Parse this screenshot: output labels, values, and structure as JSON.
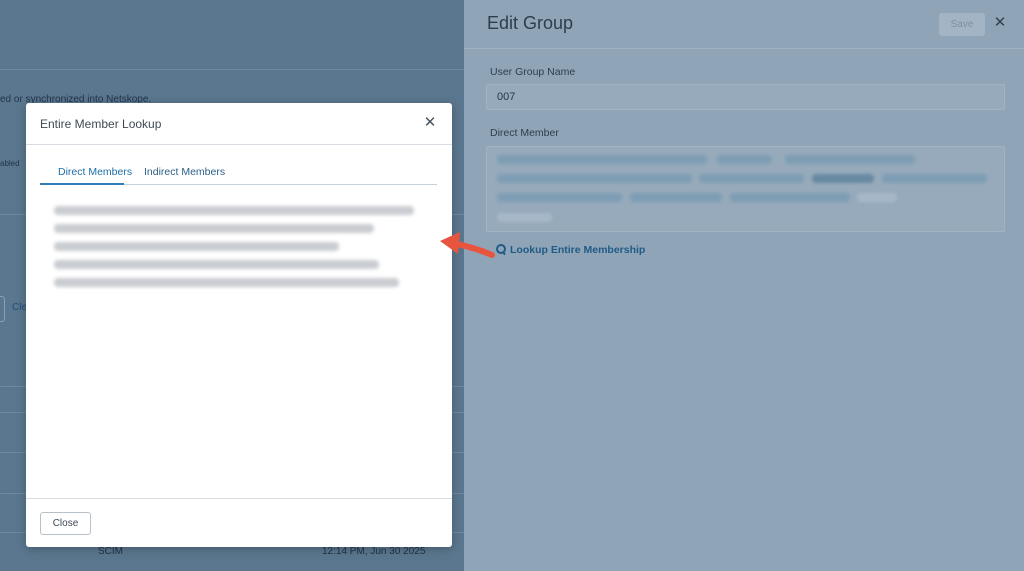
{
  "background": {
    "text_line1": "ed or synchronized into Netskope.",
    "text_line2": "abled",
    "text_fragment": "Cle",
    "row_source": "SCIM",
    "row_timestamp": "12:14 PM, Jun 30 2025"
  },
  "drawer": {
    "title": "Edit Group",
    "save_label": "Save",
    "close_icon": "close-icon",
    "group_name_label": "User Group Name",
    "group_name_value": "007",
    "direct_member_label": "Direct Member",
    "lookup_link_label": "Lookup Entire Membership",
    "lookup_icon": "search-icon"
  },
  "modal": {
    "title": "Entire Member Lookup",
    "close_icon": "close-icon",
    "tabs": [
      {
        "label": "Direct Members",
        "active": true
      },
      {
        "label": "Indirect Members",
        "active": false
      }
    ],
    "close_button_label": "Close"
  },
  "colors": {
    "overlay": "#5b778f",
    "accent": "#1f6fa6",
    "annotation_arrow": "#e8553f"
  }
}
